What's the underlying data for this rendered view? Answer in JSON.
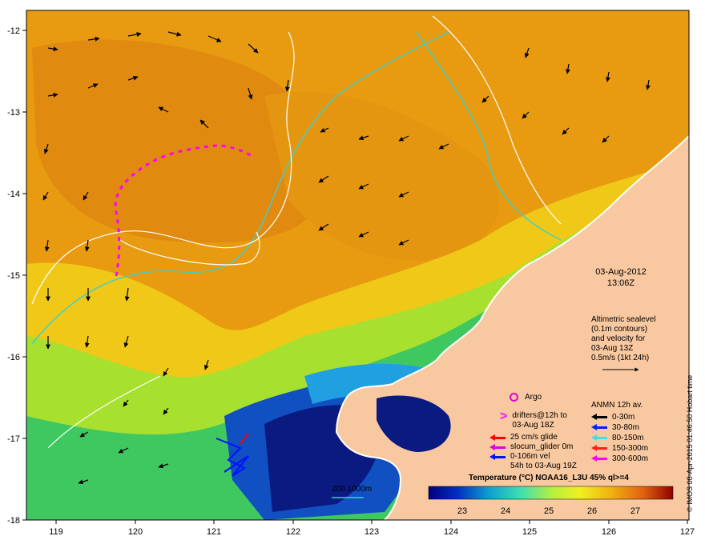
{
  "map": {
    "x_ticks": [
      "119",
      "120",
      "121",
      "122",
      "123",
      "124",
      "125",
      "126",
      "127"
    ],
    "y_ticks": [
      "-12",
      "-13",
      "-14",
      "-15",
      "-16",
      "-17",
      "-18"
    ],
    "colors": {
      "land": "#f8c8a0",
      "coast": "#ffffff",
      "contour_200": "#40d0c8",
      "contour_1000": "#ffffff",
      "sea_warm": "#e89a10",
      "sea_mid": "#a8e030",
      "sea_cool": "#1040a0"
    }
  },
  "date": {
    "line1": "03-Aug-2012",
    "line2": "13:06Z"
  },
  "altimetry": {
    "lines": [
      "Altimetric sealevel",
      "(0.1m contours)",
      "and velocity for",
      "03-Aug 13Z"
    ],
    "scale": "0.5m/s (1kt 24h)"
  },
  "legend": {
    "argo": "Argo",
    "drifters": [
      "drifters@12h to",
      "03-Aug 18Z"
    ],
    "glider_items": [
      {
        "label": "25 cm/s glide",
        "color": "#ff0000"
      },
      {
        "label": "slocum_glider 0m",
        "color": "#e000e0"
      },
      {
        "label": "0-106m vel",
        "color": "#0010ff"
      }
    ],
    "glider_note": "54h to 03-Aug 19Z"
  },
  "anmn": {
    "title": "ANMN 12h av.",
    "items": [
      {
        "label": "0-30m",
        "color": "#000000"
      },
      {
        "label": "30-80m",
        "color": "#0020ff"
      },
      {
        "label": "80-150m",
        "color": "#40e0e0"
      },
      {
        "label": "150-300m",
        "color": "#ff2020"
      },
      {
        "label": "300-600m",
        "color": "#ff00ff"
      }
    ]
  },
  "colorbar": {
    "title": "Temperature (°C) NOAA16_L3U 45% ql>=4",
    "ticks": [
      "23",
      "24",
      "25",
      "26",
      "27"
    ],
    "range": [
      22.5,
      27.8
    ]
  },
  "contour_scale": "200  1000m",
  "credit": "© IMOS 08-Apr-2015 01:46:50 Hobart time"
}
